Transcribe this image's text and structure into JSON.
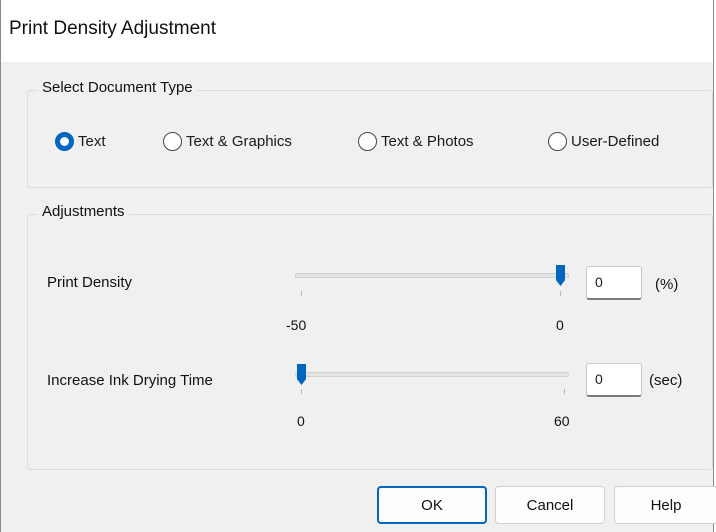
{
  "window": {
    "title": "Print Density Adjustment"
  },
  "document_type": {
    "legend": "Select Document Type",
    "options": [
      {
        "label": "Text",
        "selected": true
      },
      {
        "label": "Text & Graphics",
        "selected": false
      },
      {
        "label": "Text & Photos",
        "selected": false
      },
      {
        "label": "User-Defined",
        "selected": false
      }
    ]
  },
  "adjustments": {
    "legend": "Adjustments",
    "print_density": {
      "label": "Print Density",
      "min_label": "-50",
      "max_label": "0",
      "value": "0",
      "unit": "(%)"
    },
    "drying_time": {
      "label": "Increase Ink Drying Time",
      "min_label": "0",
      "max_label": "60",
      "value": "0",
      "unit": "(sec)"
    }
  },
  "buttons": {
    "ok": "OK",
    "cancel": "Cancel",
    "help": "Help"
  },
  "colors": {
    "accent": "#0067c0"
  }
}
